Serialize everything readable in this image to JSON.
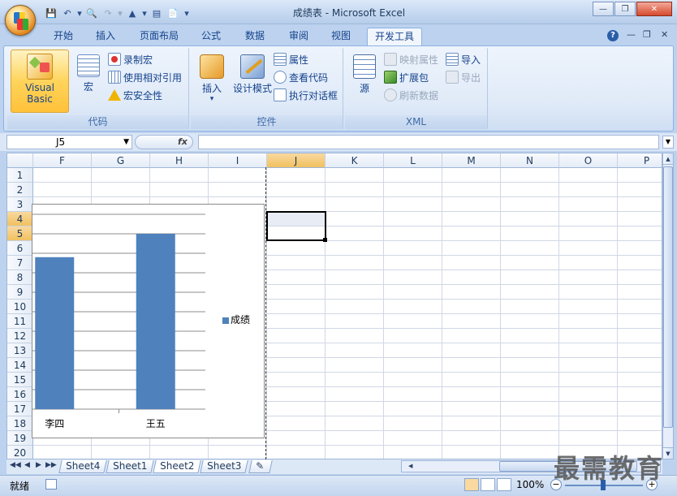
{
  "window": {
    "title": "成绩表 - Microsoft Excel"
  },
  "qat_icons": [
    "save-icon",
    "undo-icon",
    "print-preview-icon",
    "redo-icon",
    "sort-icon",
    "form-icon",
    "new-icon"
  ],
  "tabs": [
    {
      "label": "开始"
    },
    {
      "label": "插入"
    },
    {
      "label": "页面布局"
    },
    {
      "label": "公式"
    },
    {
      "label": "数据"
    },
    {
      "label": "审阅"
    },
    {
      "label": "视图"
    },
    {
      "label": "开发工具",
      "active": true
    }
  ],
  "ribbon": {
    "code": {
      "label": "代码",
      "visual_basic": "Visual Basic",
      "macros": "宏",
      "record_macro": "录制宏",
      "relative_ref": "使用相对引用",
      "macro_security": "宏安全性"
    },
    "controls": {
      "label": "控件",
      "insert": "插入",
      "design_mode": "设计模式",
      "properties": "属性",
      "view_code": "查看代码",
      "run_dialog": "执行对话框"
    },
    "xml": {
      "label": "XML",
      "source": "源",
      "map_properties": "映射属性",
      "expansion_packs": "扩展包",
      "refresh_data": "刷新数据",
      "import": "导入",
      "export": "导出"
    }
  },
  "formula": {
    "name_box": "J5",
    "fx": "fx",
    "value": ""
  },
  "sheet": {
    "columns": [
      "F",
      "G",
      "H",
      "I",
      "J",
      "K",
      "L",
      "M",
      "N",
      "O",
      "P"
    ],
    "rows": [
      "1",
      "2",
      "3",
      "4",
      "5",
      "6",
      "7",
      "8",
      "9",
      "10",
      "11",
      "12",
      "13",
      "14",
      "15",
      "16",
      "17",
      "18",
      "19",
      "20"
    ],
    "active_cell": "J5"
  },
  "chart_data": {
    "type": "bar",
    "categories": [
      "李四",
      "王五"
    ],
    "series": [
      {
        "name": "成绩",
        "values": [
          78,
          90
        ]
      }
    ],
    "ylim": [
      0,
      100
    ],
    "grid": true,
    "legend": "right"
  },
  "sheet_tabs": [
    {
      "label": "Sheet4"
    },
    {
      "label": "Sheet1"
    },
    {
      "label": "Sheet2",
      "active": true
    },
    {
      "label": "Sheet3"
    }
  ],
  "status": {
    "ready": "就绪",
    "zoom": "100%"
  },
  "watermark": "最需教育"
}
